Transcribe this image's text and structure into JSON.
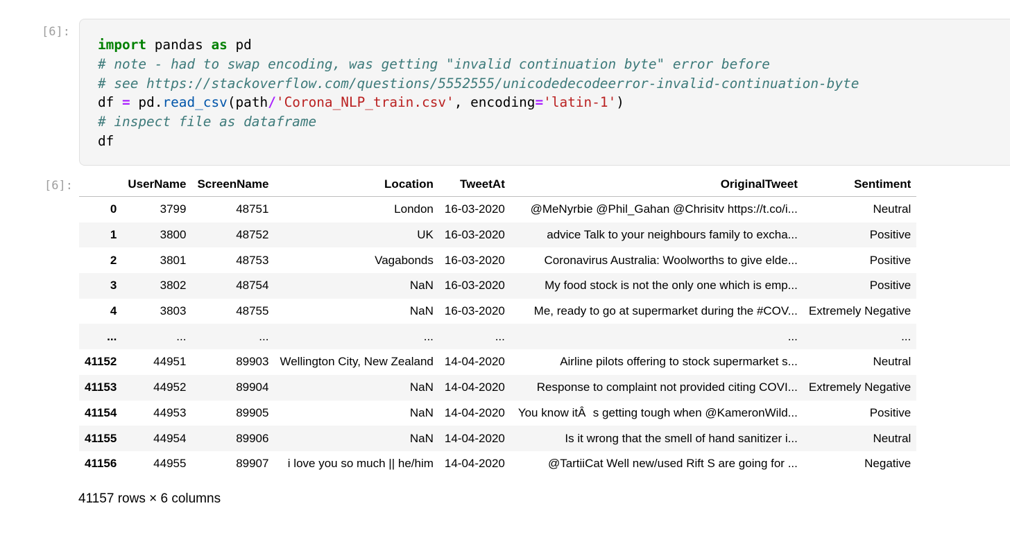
{
  "input_cell": {
    "prompt": "[6]:",
    "code": {
      "line1": {
        "kw1": "import",
        "mod": " pandas ",
        "kw2": "as",
        "alias": " pd"
      },
      "line2": "# note - had to swap encoding, was getting \"invalid continuation byte\" error before",
      "line3": "# see https://stackoverflow.com/questions/5552555/unicodedecodeerror-invalid-continuation-byte",
      "line4": {
        "a": "df ",
        "eq": "=",
        "b": " pd.",
        "fn": "read_csv",
        "c": "(path",
        "slash": "/",
        "s1": "'Corona_NLP_train.csv'",
        "d": ", encoding",
        "eq2": "=",
        "s2": "'latin-1'",
        "e": ")"
      },
      "line5": "# inspect file as dataframe",
      "line6": "df"
    }
  },
  "output_cell": {
    "prompt": "[6]:",
    "columns": [
      "",
      "UserName",
      "ScreenName",
      "Location",
      "TweetAt",
      "OriginalTweet",
      "Sentiment"
    ],
    "rows": [
      [
        "0",
        "3799",
        "48751",
        "London",
        "16-03-2020",
        "@MeNyrbie @Phil_Gahan @Chrisitv https://t.co/i...",
        "Neutral"
      ],
      [
        "1",
        "3800",
        "48752",
        "UK",
        "16-03-2020",
        "advice Talk to your neighbours family to excha...",
        "Positive"
      ],
      [
        "2",
        "3801",
        "48753",
        "Vagabonds",
        "16-03-2020",
        "Coronavirus Australia: Woolworths to give elde...",
        "Positive"
      ],
      [
        "3",
        "3802",
        "48754",
        "NaN",
        "16-03-2020",
        "My food stock is not the only one which is emp...",
        "Positive"
      ],
      [
        "4",
        "3803",
        "48755",
        "NaN",
        "16-03-2020",
        "Me, ready to go at supermarket during the #COV...",
        "Extremely Negative"
      ],
      [
        "...",
        "...",
        "...",
        "...",
        "...",
        "...",
        "..."
      ],
      [
        "41152",
        "44951",
        "89903",
        "Wellington City, New Zealand",
        "14-04-2020",
        "Airline pilots offering to stock supermarket s...",
        "Neutral"
      ],
      [
        "41153",
        "44952",
        "89904",
        "NaN",
        "14-04-2020",
        "Response to complaint not provided citing COVI...",
        "Extremely Negative"
      ],
      [
        "41154",
        "44953",
        "89905",
        "NaN",
        "14-04-2020",
        "You know itÂs getting tough when @KameronWild...",
        "Positive"
      ],
      [
        "41155",
        "44954",
        "89906",
        "NaN",
        "14-04-2020",
        "Is it wrong that the smell of hand sanitizer i...",
        "Neutral"
      ],
      [
        "41156",
        "44955",
        "89907",
        "i love you so much || he/him",
        "14-04-2020",
        "@TartiiCat Well new/used Rift S are going for ...",
        "Negative"
      ]
    ],
    "shape_text": "41157 rows × 6 columns"
  }
}
